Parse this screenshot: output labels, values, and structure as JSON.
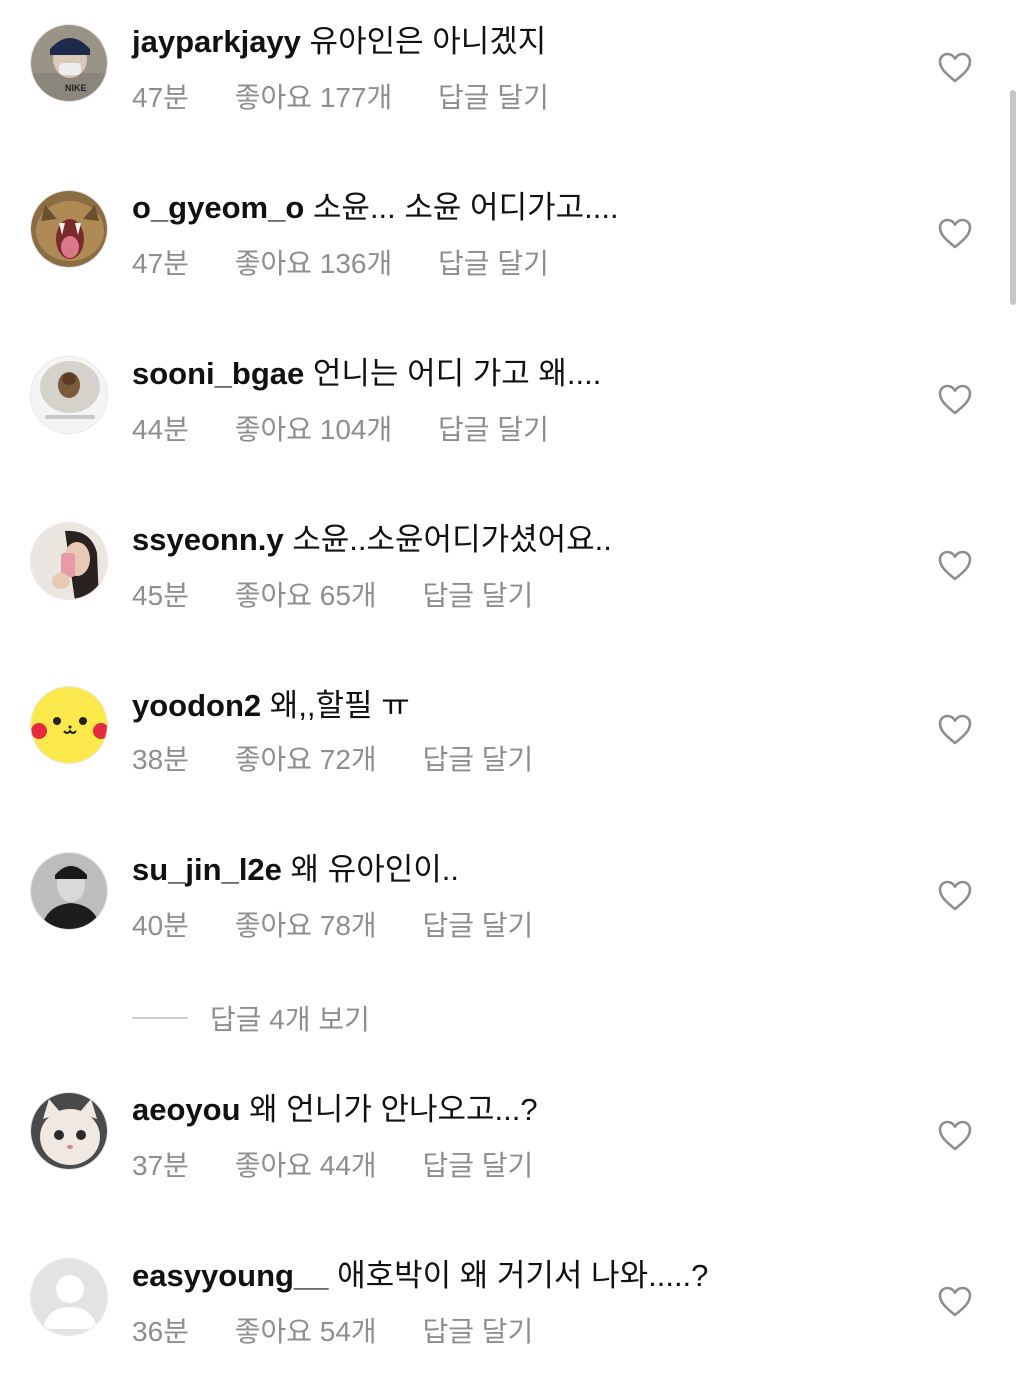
{
  "comments": [
    {
      "username": "jayparkjayy",
      "text": "유아인은 아니겠지",
      "time": "47분",
      "likes": "좋아요 177개",
      "reply": "답글 달기"
    },
    {
      "username": "o_gyeom_o",
      "text": "소윤... 소윤 어디가고....",
      "time": "47분",
      "likes": "좋아요 136개",
      "reply": "답글 달기"
    },
    {
      "username": "sooni_bgae",
      "text": "언니는 어디 가고 왜....",
      "time": "44분",
      "likes": "좋아요 104개",
      "reply": "답글 달기"
    },
    {
      "username": "ssyeonn.y",
      "text": "소윤..소윤어디가셨어요..",
      "time": "45분",
      "likes": "좋아요 65개",
      "reply": "답글 달기"
    },
    {
      "username": "yoodon2",
      "text": "왜,,할필 ㅠ",
      "time": "38분",
      "likes": "좋아요 72개",
      "reply": "답글 달기"
    },
    {
      "username": "su_jin_l2e",
      "text": "왜 유아인이..",
      "time": "40분",
      "likes": "좋아요 78개",
      "reply": "답글 달기"
    },
    {
      "username": "aeoyou",
      "text": "왜 언니가 안나오고...?",
      "time": "37분",
      "likes": "좋아요 44개",
      "reply": "답글 달기"
    },
    {
      "username": "easyyoung__",
      "text": "애호박이 왜 거기서 나와.....?",
      "time": "36분",
      "likes": "좋아요 54개",
      "reply": "답글 달기"
    }
  ],
  "view_replies": "답글 4개 보기",
  "icons": {
    "like": "heart-outline-icon"
  },
  "colors": {
    "text": "#111111",
    "meta": "#8e8e8e",
    "heart": "#8e8e8e"
  }
}
